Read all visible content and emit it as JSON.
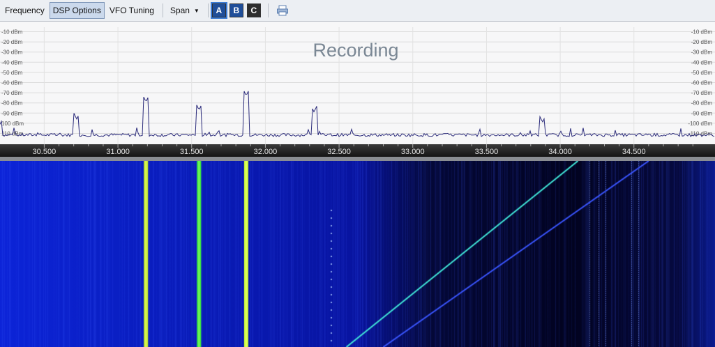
{
  "toolbar": {
    "items": [
      {
        "label": "Frequency",
        "active": false
      },
      {
        "label": "DSP Options",
        "active": true
      },
      {
        "label": "VFO Tuning",
        "active": false
      }
    ],
    "span_label": "Span",
    "vfo_buttons": [
      {
        "label": "A",
        "color": "#1f4e99",
        "selected": true
      },
      {
        "label": "B",
        "color": "#1f4e99",
        "selected": false
      },
      {
        "label": "C",
        "color": "#2e2e2e",
        "selected": false
      }
    ]
  },
  "spectrum": {
    "overlay_text": "Recording",
    "dbm_levels": [
      -10,
      -20,
      -30,
      -40,
      -50,
      -60,
      -70,
      -80,
      -90,
      -100,
      -110
    ],
    "dbm_labels": [
      "-10 dBm",
      "-20 dBm",
      "-30 dBm",
      "-40 dBm",
      "-50 dBm",
      "-60 dBm",
      "-70 dBm",
      "-80 dBm",
      "-90 dBm",
      "-100 dBm",
      "-110 dBm"
    ],
    "left_labels": [
      "-10 dBm",
      "-20 dBm",
      "-30 dBm",
      "-40 dBm",
      "-50 dBm",
      "-60 dBm",
      "-70 dBm",
      "-80 dBm",
      "-90 dBm",
      "100 dBm",
      "110 dBm"
    ],
    "freq_range_mhz": [
      30.2,
      35.05
    ],
    "db_range": [
      0,
      -118
    ],
    "peaks": [
      {
        "freq": 31.19,
        "db": -79
      },
      {
        "freq": 31.55,
        "db": -87
      },
      {
        "freq": 31.87,
        "db": -73
      },
      {
        "freq": 32.33,
        "db": -89
      },
      {
        "freq": 33.88,
        "db": -99
      },
      {
        "freq": 30.72,
        "db": -96
      },
      {
        "freq": 30.2,
        "db": -101
      }
    ]
  },
  "frequency_scale": {
    "ticks": [
      "30.500",
      "31.000",
      "31.500",
      "32.000",
      "32.500",
      "33.000",
      "33.500",
      "34.000",
      "34.500"
    ],
    "values": [
      30.5,
      31.0,
      31.5,
      32.0,
      32.5,
      33.0,
      33.5,
      34.0,
      34.5
    ]
  },
  "waterfall": {
    "signals": [
      {
        "freq": 31.19,
        "color": "#c8f032"
      },
      {
        "freq": 31.55,
        "color": "#3cf03c"
      },
      {
        "freq": 31.87,
        "color": "#d2ff3c"
      }
    ],
    "sweeps": [
      {
        "from_freq": 32.55,
        "to_freq": 34.12,
        "color": "#40e6d8"
      },
      {
        "from_freq": 32.8,
        "to_freq": 34.6,
        "color": "#3a55ff"
      }
    ]
  },
  "colors": {
    "spectrum_trace": "#2a2a7a",
    "waterfall_bg": "#0a1cbf",
    "accent": "#3a7bd5"
  }
}
